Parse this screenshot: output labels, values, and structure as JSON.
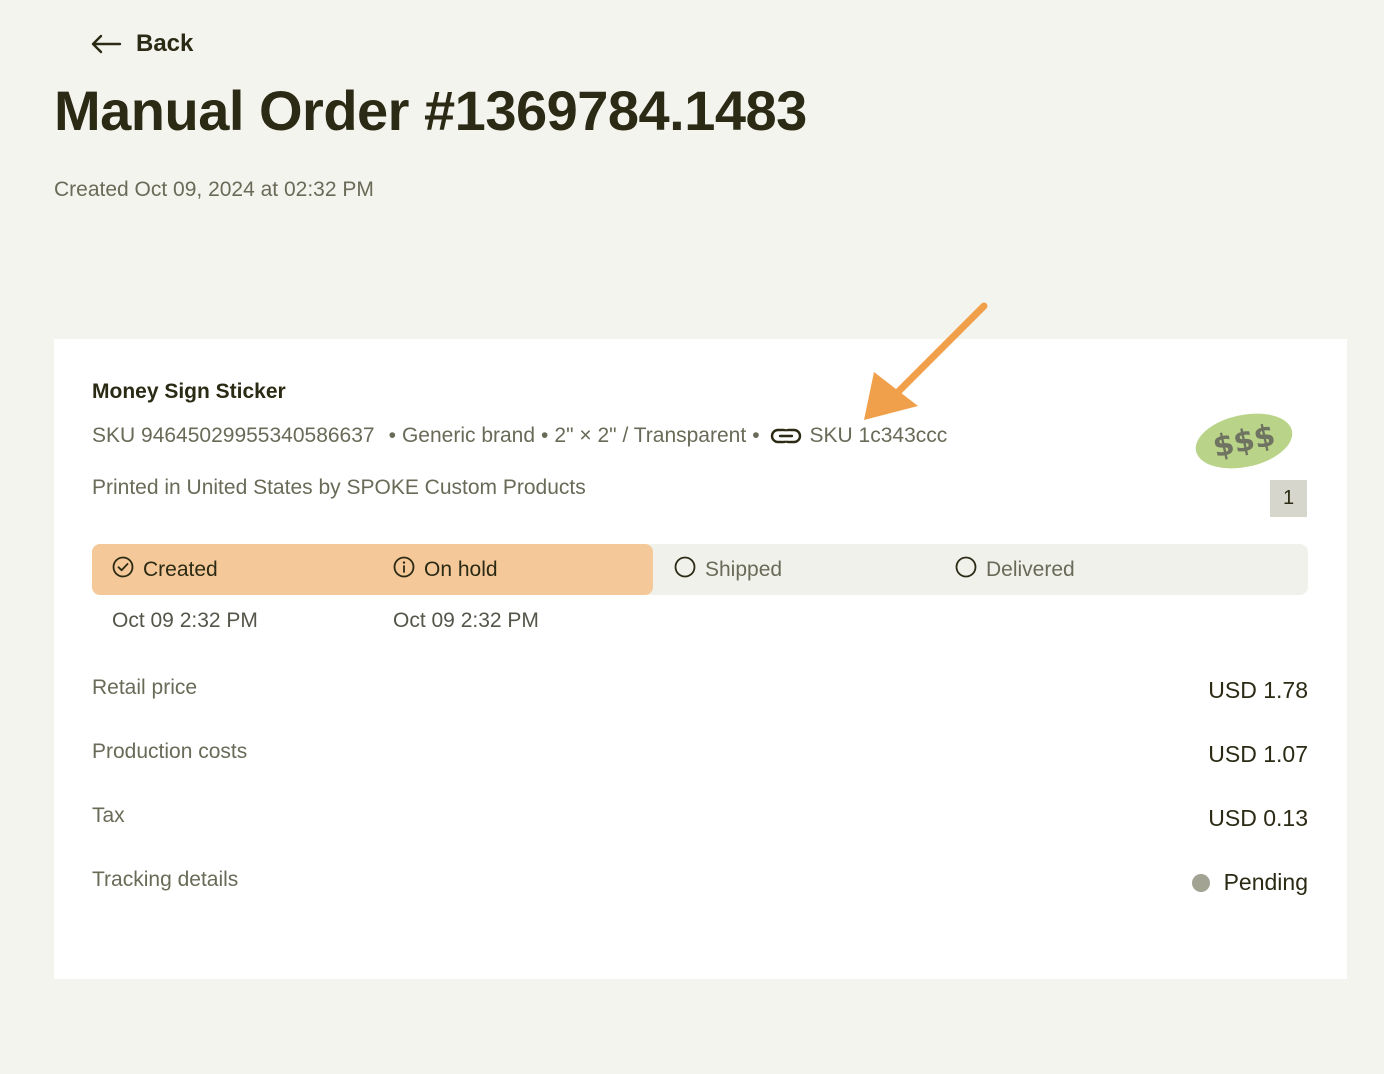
{
  "nav": {
    "back_label": "Back"
  },
  "order": {
    "title": "Manual Order #1369784.1483",
    "created": "Created Oct 09, 2024 at 02:32 PM"
  },
  "item": {
    "name": "Money Sign Sticker",
    "sku": "SKU 94645029955340586637",
    "brand": "Generic brand",
    "variant": "2\" × 2\" / Transparent",
    "separator": "•",
    "linked_sku": "SKU 1c343ccc",
    "printed": "Printed in United States by SPOKE Custom Products",
    "quantity": "1",
    "thumbnail_text": "$$$"
  },
  "tracking_steps": [
    {
      "label": "Created",
      "date": "Oct 09 2:32 PM",
      "icon": "check-circle-icon",
      "state": "done"
    },
    {
      "label": "On hold",
      "date": "Oct 09 2:32 PM",
      "icon": "info-circle-icon",
      "state": "done"
    },
    {
      "label": "Shipped",
      "date": "",
      "icon": "empty-circle-icon",
      "state": "pending"
    },
    {
      "label": "Delivered",
      "date": "",
      "icon": "empty-circle-icon",
      "state": "pending"
    }
  ],
  "summary": [
    {
      "label": "Retail price",
      "value": "USD 1.78"
    },
    {
      "label": "Production costs",
      "value": "USD 1.07"
    },
    {
      "label": "Tax",
      "value": "USD 0.13"
    },
    {
      "label": "Tracking details",
      "value": "Pending"
    }
  ],
  "colors": {
    "background": "#f4f4ef",
    "card": "#ffffff",
    "progress_done": "#f4c898",
    "progress_track": "#f1f1ec",
    "annotation_arrow": "#f0a04a",
    "status_pending_dot": "#a3a394"
  }
}
